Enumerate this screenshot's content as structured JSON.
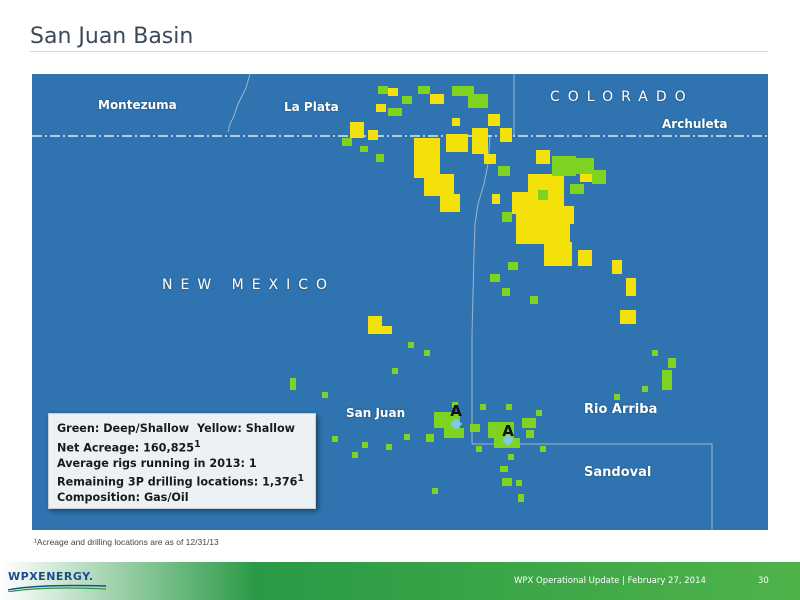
{
  "slide": {
    "title": "San Juan Basin",
    "footnote": "¹Acreage and drilling locations are as of 12/31/13"
  },
  "map": {
    "labels": {
      "montezuma": "Montezuma",
      "la_plata": "La Plata",
      "colorado": "COLORADO",
      "archuleta": "Archuleta",
      "new_mexico": "NEW MEXICO",
      "san_juan": "San Juan",
      "rio_arriba": "Rio Arriba",
      "sandoval": "Sandoval"
    },
    "rig_marker_symbol": "A",
    "colors": {
      "water_background": "#2f74b0",
      "deep_shallow_acreage": "#7ed321",
      "shallow_acreage": "#f5e10a",
      "state_border": "#dfe8e0",
      "county_line": "#9fb4c8"
    }
  },
  "legend": {
    "green_label": "Green: Deep/Shallow",
    "yellow_label": "Yellow: Shallow",
    "net_acreage_label": "Net Acreage: 160,825",
    "net_acreage_sup": "1",
    "rigs_label": "Average rigs running in 2013: 1",
    "remaining_label": "Remaining 3P drilling locations: 1,376",
    "remaining_sup": "1",
    "composition_label": "Composition:  Gas/Oil"
  },
  "footer": {
    "logo_text": "WPXENERGY.",
    "update_text": "WPX Operational Update  |  February 27, 2014",
    "page_number": "30"
  }
}
